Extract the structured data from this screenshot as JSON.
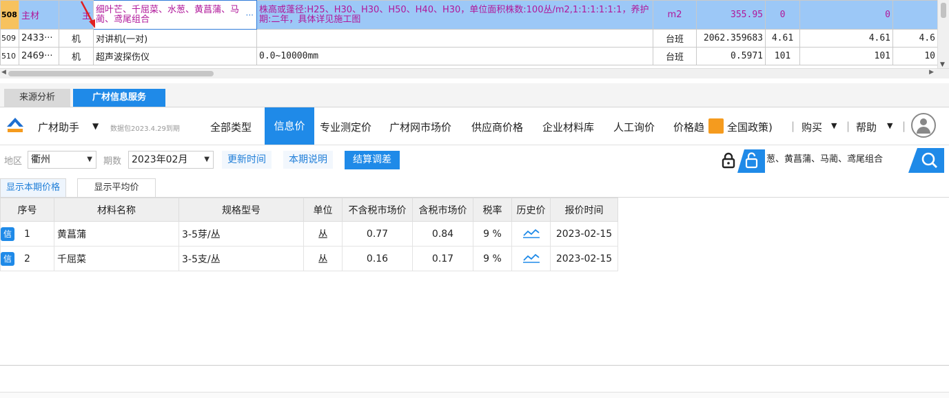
{
  "top_grid": {
    "rows": [
      {
        "num": "508",
        "code": "主材",
        "type": "主",
        "name": "细叶芒、千屈菜、水葱、黄菖蒲、马蔺、鸢尾组合",
        "spec": "株高或蓬径:H25、H30、H30、H50、H40、H30，单位面积株数:100丛/m2,1:1:1:1:1:1，养护期:二年，具体详见施工图",
        "unit": "m2",
        "price": "355.95",
        "c1": "0",
        "c2": "0",
        "c3": ""
      },
      {
        "num": "509",
        "code": "2433···",
        "type": "机",
        "name": "对讲机(一对)",
        "spec": "",
        "unit": "台班",
        "price": "2062.359683",
        "c1": "4.61",
        "c2": "4.61",
        "c3": "4.6"
      },
      {
        "num": "510",
        "code": "2469···",
        "type": "机",
        "name": "超声波探伤仪",
        "spec": "0.0~10000mm",
        "unit": "台班",
        "price": "0.5971",
        "c1": "101",
        "c2": "101",
        "c3": "10"
      }
    ],
    "ellipsis": "···"
  },
  "tabs": {
    "source": "来源分析",
    "service": "广材信息服务"
  },
  "nav": {
    "brand": "广材助手",
    "brand_dd": "▼",
    "db_version": "数据包2023.4.29到期",
    "items": [
      "全部类型",
      "信息价",
      "专业测定价",
      "广材网市场价",
      "供应商价格",
      "企业材料库",
      "人工询价",
      "价格趋"
    ],
    "policy": "全国政策)",
    "buy": "购买",
    "help": "帮助",
    "sep": "|",
    "dd": "▼"
  },
  "filter": {
    "region_label": "地区",
    "region": "衢州",
    "period_label": "期数",
    "period": "2023年02月",
    "dd": "▼",
    "update_time": "更新时间",
    "period_note": "本期说明",
    "settle": "结算调差",
    "search_value": "葱、黄菖蒲、马蔺、鸢尾组合"
  },
  "subtabs": {
    "current": "显示本期价格",
    "average": "显示平均价"
  },
  "results": {
    "headers": [
      "序号",
      "材料名称",
      "规格型号",
      "单位",
      "不含税市场价",
      "含税市场价",
      "税率",
      "历史价",
      "报价时间"
    ],
    "badge": "信",
    "rows": [
      {
        "no": "1",
        "name": "黄菖蒲",
        "spec": "3-5芽/丛",
        "unit": "丛",
        "price_ex": "0.77",
        "price_in": "0.84",
        "tax": "9 %",
        "date": "2023-02-15"
      },
      {
        "no": "2",
        "name": "千屈菜",
        "spec": "3-5支/丛",
        "unit": "丛",
        "price_ex": "0.16",
        "price_in": "0.17",
        "tax": "9 %",
        "date": "2023-02-15"
      }
    ]
  },
  "colors": {
    "accent": "#1f8ae8",
    "selected_row": "#9cc8f7",
    "row_number_highlight": "#f7c25e",
    "magenta_text": "#b0179a"
  }
}
